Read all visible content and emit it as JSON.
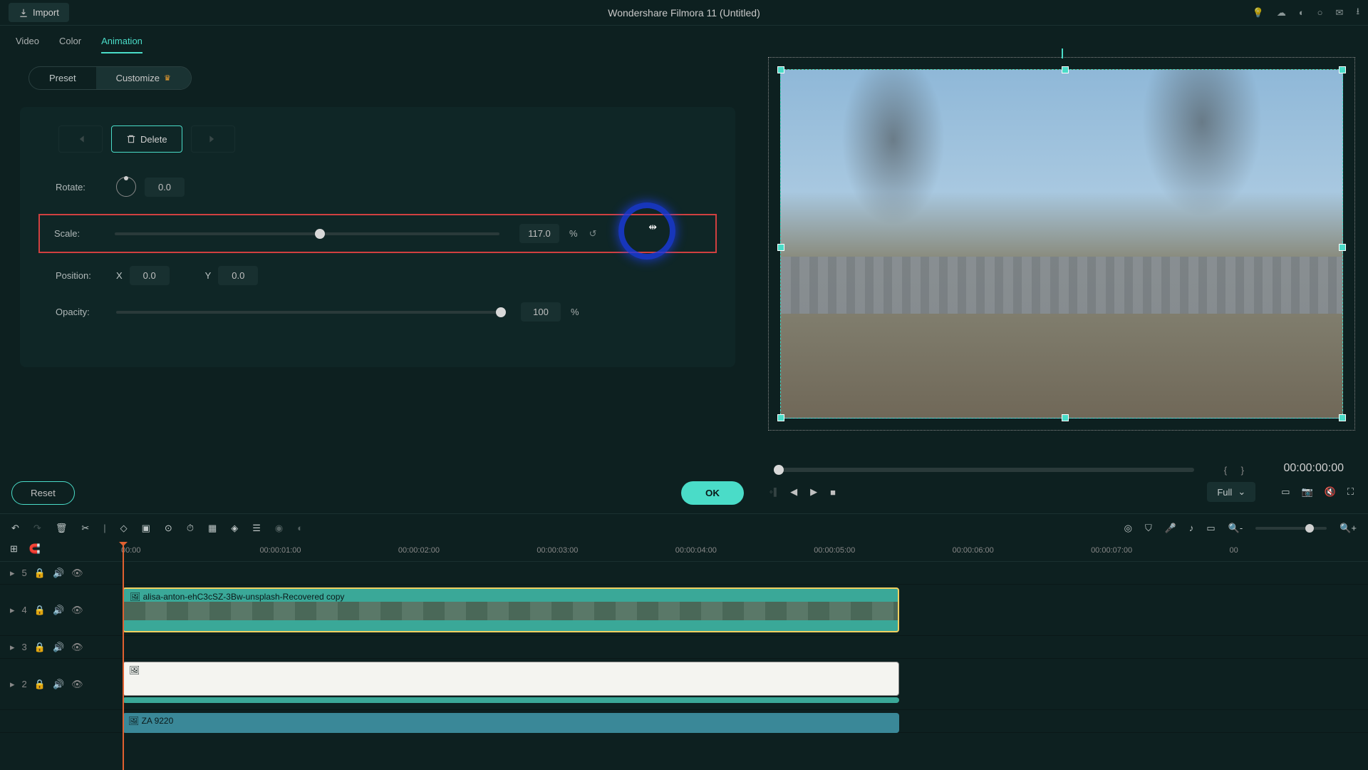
{
  "titlebar": {
    "import_label": "Import",
    "app_title": "Wondershare Filmora 11 (Untitled)"
  },
  "tabs": {
    "video": "Video",
    "color": "Color",
    "animation": "Animation"
  },
  "subtoggle": {
    "preset": "Preset",
    "customize": "Customize"
  },
  "nav": {
    "delete": "Delete"
  },
  "props": {
    "rotate_label": "Rotate:",
    "rotate_value": "0.0",
    "scale_label": "Scale:",
    "scale_value": "117.0",
    "scale_unit": "%",
    "position_label": "Position:",
    "pos_x_label": "X",
    "pos_x_value": "0.0",
    "pos_y_label": "Y",
    "pos_y_value": "0.0",
    "opacity_label": "Opacity:",
    "opacity_value": "100",
    "opacity_unit": "%"
  },
  "buttons": {
    "reset": "Reset",
    "ok": "OK"
  },
  "player": {
    "timecode": "00:00:00:00",
    "quality": "Full"
  },
  "ruler": [
    "00:00",
    "00:00:01:00",
    "00:00:02:00",
    "00:00:03:00",
    "00:00:04:00",
    "00:00:05:00",
    "00:00:06:00",
    "00:00:07:00",
    "00"
  ],
  "tracks": {
    "t5": "5",
    "t4": "4",
    "t3": "3",
    "t2": "2",
    "clip1_name": "alisa-anton-ehC3cSZ-3Bw-unsplash-Recovered copy",
    "clip2_name": "ZA 9220"
  }
}
